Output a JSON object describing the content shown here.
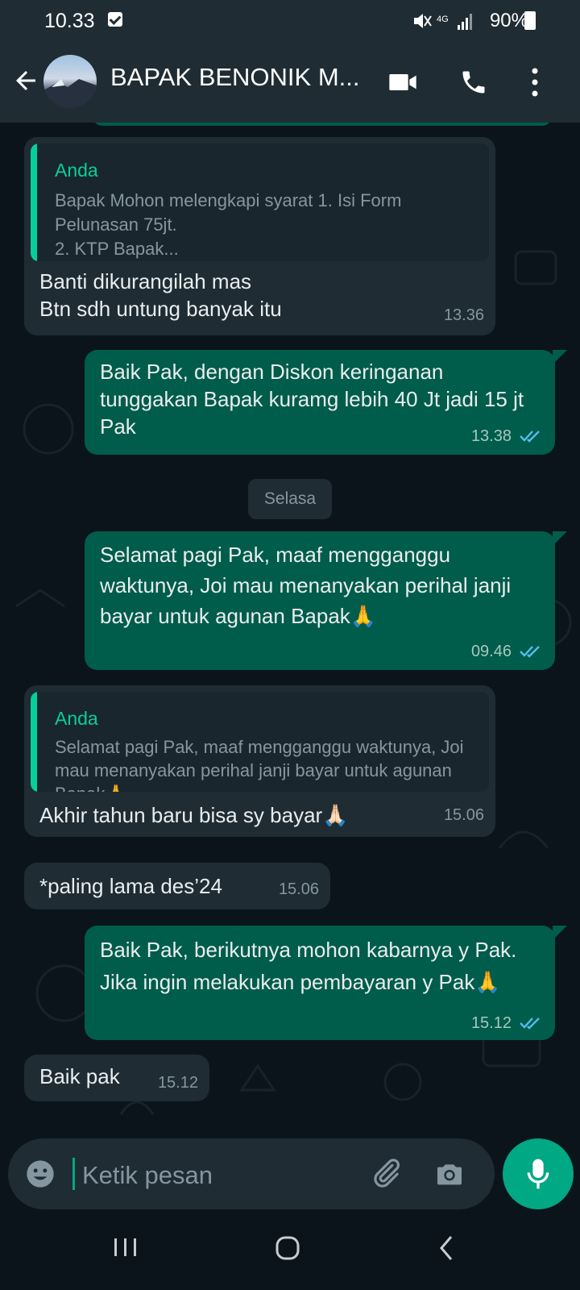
{
  "status_bar": {
    "time": "10.33",
    "network": "4G",
    "battery": "90%"
  },
  "header": {
    "contact_name": "BAPAK BENONIK M..."
  },
  "messages": [
    {
      "direction": "in",
      "quote_author": "Anda",
      "quote_text": "Bapak Mohon melengkapi syarat 1. Isi Form Pelunasan 75jt.\n   2. KTP Bapak...",
      "text": "Banti dikurangilah mas\nBtn sdh untung banyak itu",
      "time": "13.36"
    },
    {
      "direction": "out",
      "text": "Baik Pak, dengan Diskon keringanan tunggakan Bapak kuramg lebih 40 Jt jadi 15 jt  Pak",
      "time": "13.38"
    },
    {
      "direction": "out",
      "text": "Selamat pagi Pak, maaf mengganggu waktunya, Joi mau menanyakan perihal janji bayar untuk agunan Bapak🙏",
      "time": "09.46"
    },
    {
      "direction": "in",
      "quote_author": "Anda",
      "quote_text": "Selamat pagi Pak, maaf mengganggu waktunya, Joi mau menanyakan perihal janji bayar untuk agunan Bapak🙏",
      "text": "Akhir tahun baru bisa sy bayar🙏🏻",
      "time": "15.06"
    },
    {
      "direction": "in",
      "text": "*paling lama des’24",
      "time": "15.06"
    },
    {
      "direction": "out",
      "text": "Baik Pak, berikutnya mohon kabarnya y Pak. Jika ingin melakukan pembayaran y Pak🙏",
      "time": "15.12"
    },
    {
      "direction": "in",
      "text": "Baik pak",
      "time": "15.12"
    }
  ],
  "date_separator": "Selasa",
  "input": {
    "placeholder": "Ketik pesan"
  },
  "colors": {
    "accent": "#00a884",
    "outgoing": "#005c4b",
    "incoming": "#1f2c34",
    "background": "#0b141a"
  },
  "icons": [
    "back-arrow-icon",
    "video-call-icon",
    "phone-icon",
    "more-vert-icon",
    "emoji-icon",
    "attach-icon",
    "camera-icon",
    "mic-icon",
    "double-check-icon",
    "nav-recents-icon",
    "nav-home-icon",
    "nav-back-icon"
  ]
}
